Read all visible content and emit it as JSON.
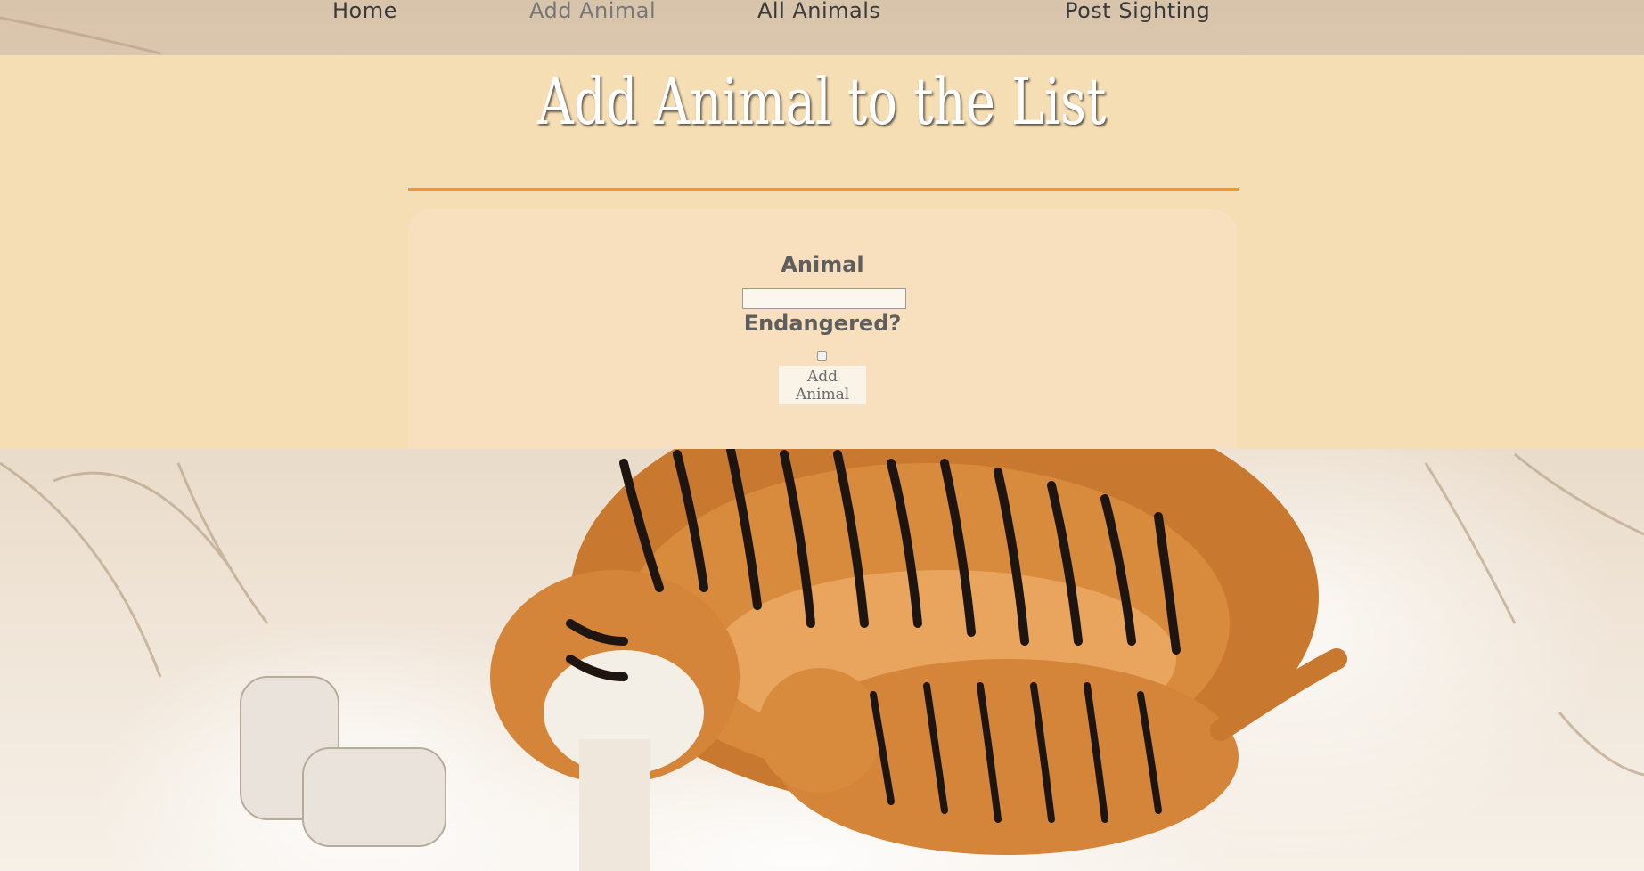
{
  "nav": {
    "items": [
      {
        "label": "Home",
        "current": false
      },
      {
        "label": "Add Animal",
        "current": true
      },
      {
        "label": "All Animals",
        "current": false
      },
      {
        "label": "Post Sighting",
        "current": false
      }
    ]
  },
  "header": {
    "title": "Add Animal to the List"
  },
  "form": {
    "animal_label": "Animal",
    "animal_value": "",
    "endangered_label": "Endangered?",
    "endangered_checked": false,
    "submit_label": "Add Animal"
  },
  "colors": {
    "panel": "#f5deb3",
    "card": "#f8dfbd",
    "divider": "#f2992e",
    "title_text": "#ffffff",
    "nav_text": "#3a3a3a"
  },
  "background": {
    "icon": "tigers-in-snow-photo"
  }
}
